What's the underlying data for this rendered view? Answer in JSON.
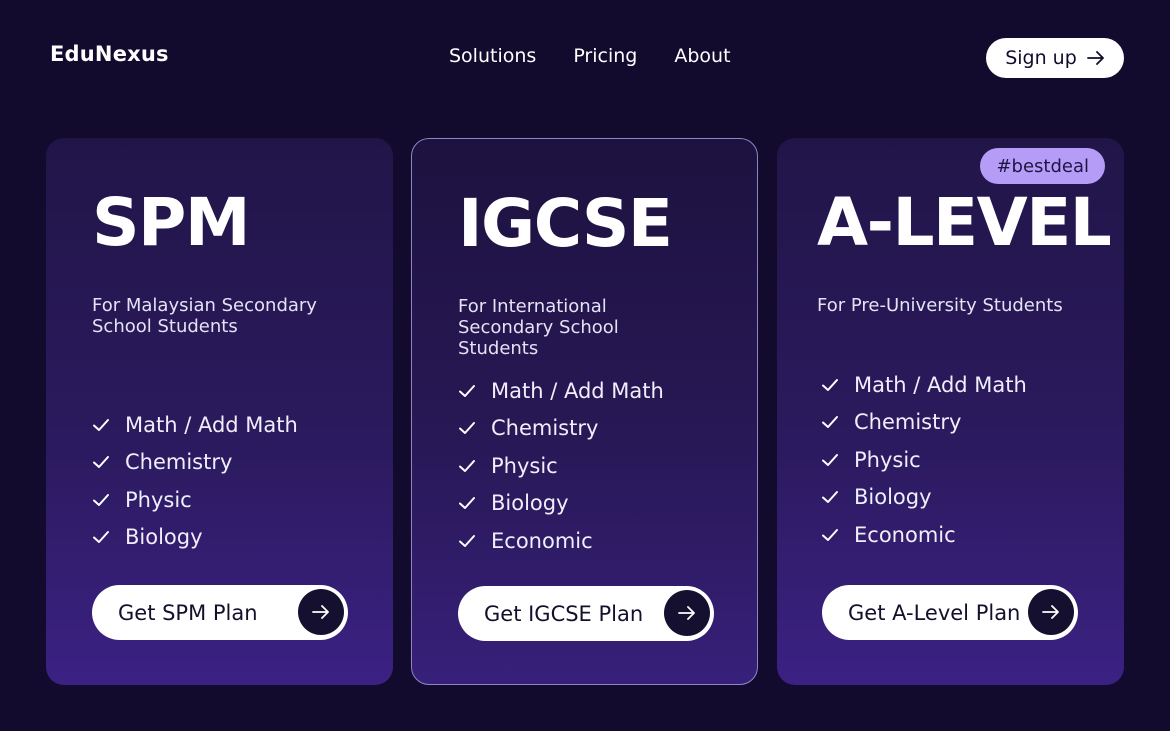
{
  "brand": {
    "name": "EduNexus"
  },
  "nav": {
    "items": [
      "Solutions",
      "Pricing",
      "About"
    ]
  },
  "signup": {
    "label": "Sign up",
    "icon": "arrow-right-icon"
  },
  "colors": {
    "background": "#120b2e",
    "badge": "#b59cf6",
    "button": "#ffffff"
  },
  "plans": [
    {
      "title": "SPM",
      "subtitle": "For Malaysian Secondary School Students",
      "features": [
        "Math / Add Math",
        "Chemistry",
        "Physic",
        "Biology"
      ],
      "button": "Get SPM Plan"
    },
    {
      "title": "IGCSE",
      "subtitle": "For International Secondary School Students",
      "features": [
        "Math / Add Math",
        "Chemistry",
        "Physic",
        "Biology",
        "Economic"
      ],
      "button": "Get IGCSE Plan"
    },
    {
      "title": "A-LEVEL",
      "subtitle": "For Pre-University Students",
      "badge": "#bestdeal",
      "features": [
        "Math / Add Math",
        "Chemistry",
        "Physic",
        "Biology",
        "Economic"
      ],
      "button": "Get A-Level Plan"
    }
  ]
}
